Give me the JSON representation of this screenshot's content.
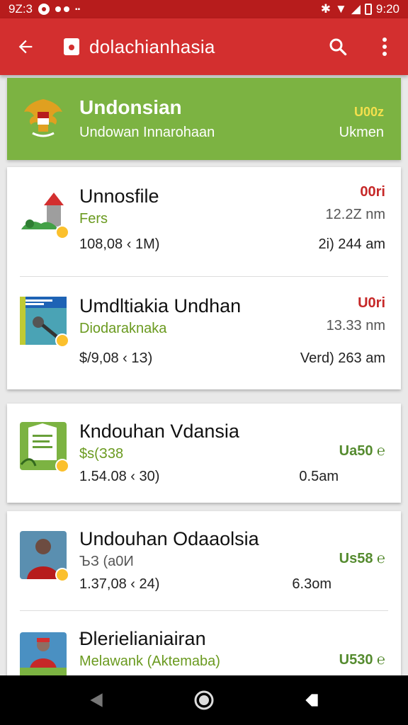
{
  "status_bar": {
    "time_left": "9Z:3",
    "time_right": "9:20"
  },
  "app_bar": {
    "title": "dolachianhasia"
  },
  "hero": {
    "title": "Undonsian",
    "subtitle": "Undowan Innarohaan",
    "badge": "U00z",
    "right_text": "Ukmen"
  },
  "cards": [
    {
      "items": [
        {
          "title": "Unnosfile",
          "subtitle": "Fers",
          "meta": "108,08 ‹ 1M)",
          "price": "00ri",
          "price_color": "red",
          "time": "12.2Z nm",
          "time2": "2i)  244 am",
          "thumb": "house-plant-icon"
        },
        {
          "title": "Umdltiakia Undhan",
          "subtitle": "Diodaraknaka",
          "meta": "$/9,08 ‹ 1З)",
          "price": "U0ri",
          "price_color": "red",
          "time": "13.33 nm",
          "time2": "Verd)  263 am",
          "thumb": "document-hammer-icon"
        }
      ]
    },
    {
      "items": [
        {
          "title": "Кndouhan Vdansia",
          "subtitle": "$s(З38",
          "meta": "1.54.08 ‹ 30)",
          "price": "Ua50 ℮",
          "price_color": "green",
          "time": "",
          "time2": "0.5am",
          "thumb": "green-document-icon"
        }
      ]
    },
    {
      "items": [
        {
          "title": "Undouhan Odaaolsia",
          "subtitle": "ЪЗ (a0И",
          "meta": "1.37,08 ‹ 24)",
          "price": "Us58 ℮",
          "price_color": "green",
          "time": "",
          "time2": "6.3om",
          "thumb": "person-portrait-icon"
        },
        {
          "title": "Ðlerielianiairan",
          "subtitle": "Melawank (Aktemaba)",
          "meta": "",
          "price": "U530 ℮",
          "price_color": "green",
          "time": "",
          "time2": "",
          "thumb": "person-scene-icon"
        }
      ]
    }
  ]
}
